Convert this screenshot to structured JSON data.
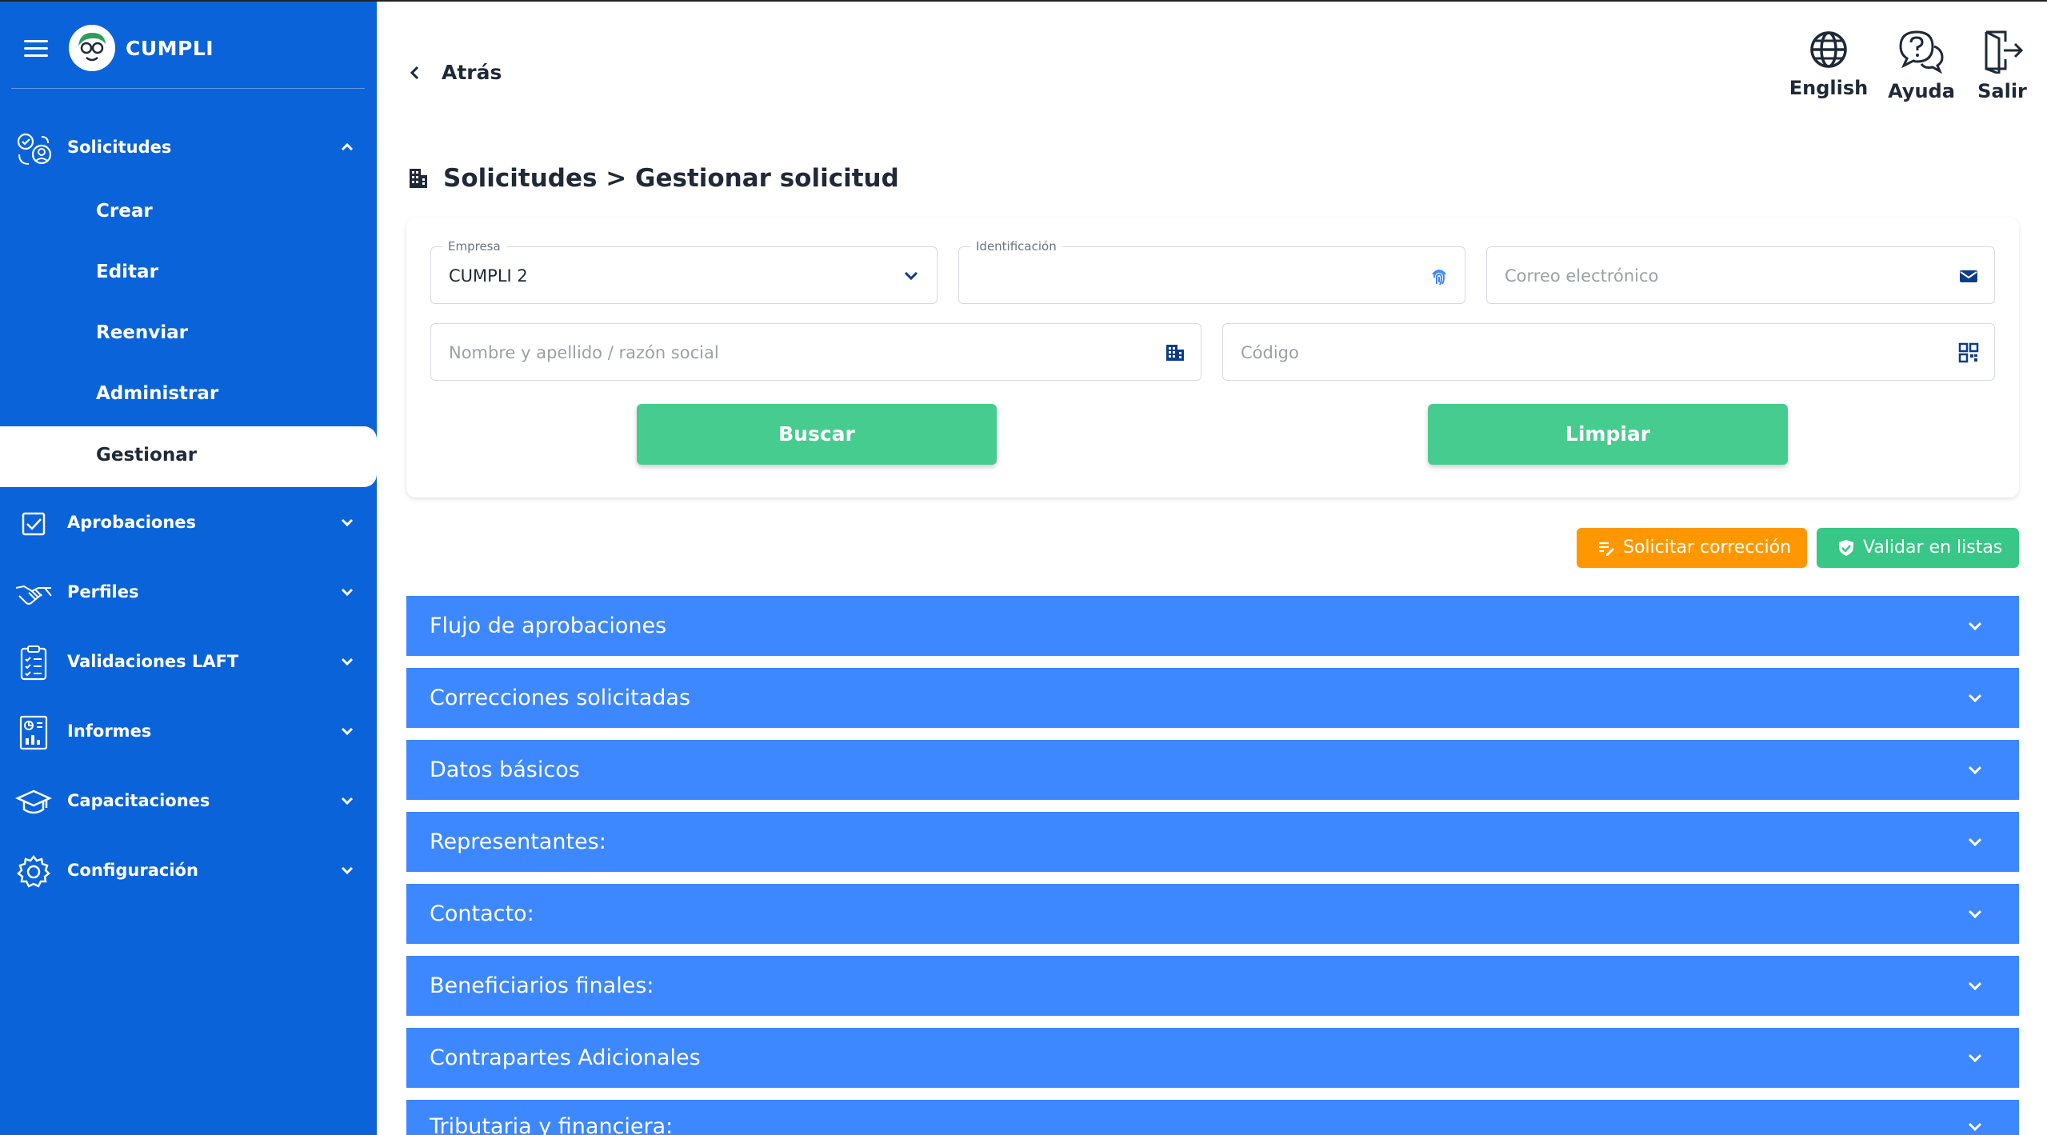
{
  "app": {
    "brand": "CUMPLI"
  },
  "colors": {
    "sidebar": "#0b63d9",
    "accordion": "#3d87ff",
    "green": "#47cc8f",
    "orange": "#ff9800",
    "validate": "#38c786"
  },
  "sidebar": {
    "sections": [
      {
        "label": "Solicitudes",
        "icon": "requests-icon",
        "expanded": true,
        "children": [
          {
            "label": "Crear"
          },
          {
            "label": "Editar"
          },
          {
            "label": "Reenviar"
          },
          {
            "label": "Administrar"
          },
          {
            "label": "Gestionar",
            "active": true
          }
        ]
      },
      {
        "label": "Aprobaciones",
        "icon": "checkbox-icon"
      },
      {
        "label": "Perfiles",
        "icon": "handshake-icon"
      },
      {
        "label": "Validaciones LAFT",
        "icon": "clipboard-icon"
      },
      {
        "label": "Informes",
        "icon": "report-icon"
      },
      {
        "label": "Capacitaciones",
        "icon": "graduation-cap-icon"
      },
      {
        "label": "Configuración",
        "icon": "gear-icon"
      }
    ]
  },
  "header": {
    "back_label": "Atrás",
    "language_label": "English",
    "help_label": "Ayuda",
    "logout_label": "Salir"
  },
  "page": {
    "title": "Solicitudes > Gestionar solicitud"
  },
  "filters": {
    "empresa": {
      "label": "Empresa",
      "value": "CUMPLI 2"
    },
    "identificacion": {
      "label": "Identificación",
      "value": ""
    },
    "correo": {
      "placeholder": "Correo electrónico"
    },
    "nombre": {
      "placeholder": "Nombre y apellido / razón social"
    },
    "codigo": {
      "placeholder": "Código"
    },
    "search_label": "Buscar",
    "clear_label": "Limpiar"
  },
  "actions": {
    "request_correction": "Solicitar corrección",
    "validate_lists": "Validar en listas"
  },
  "accordions": [
    "Flujo de aprobaciones",
    "Correcciones solicitadas",
    "Datos básicos",
    "Representantes:",
    "Contacto:",
    "Beneficiarios finales:",
    "Contrapartes Adicionales",
    "Tributaria y financiera:"
  ]
}
